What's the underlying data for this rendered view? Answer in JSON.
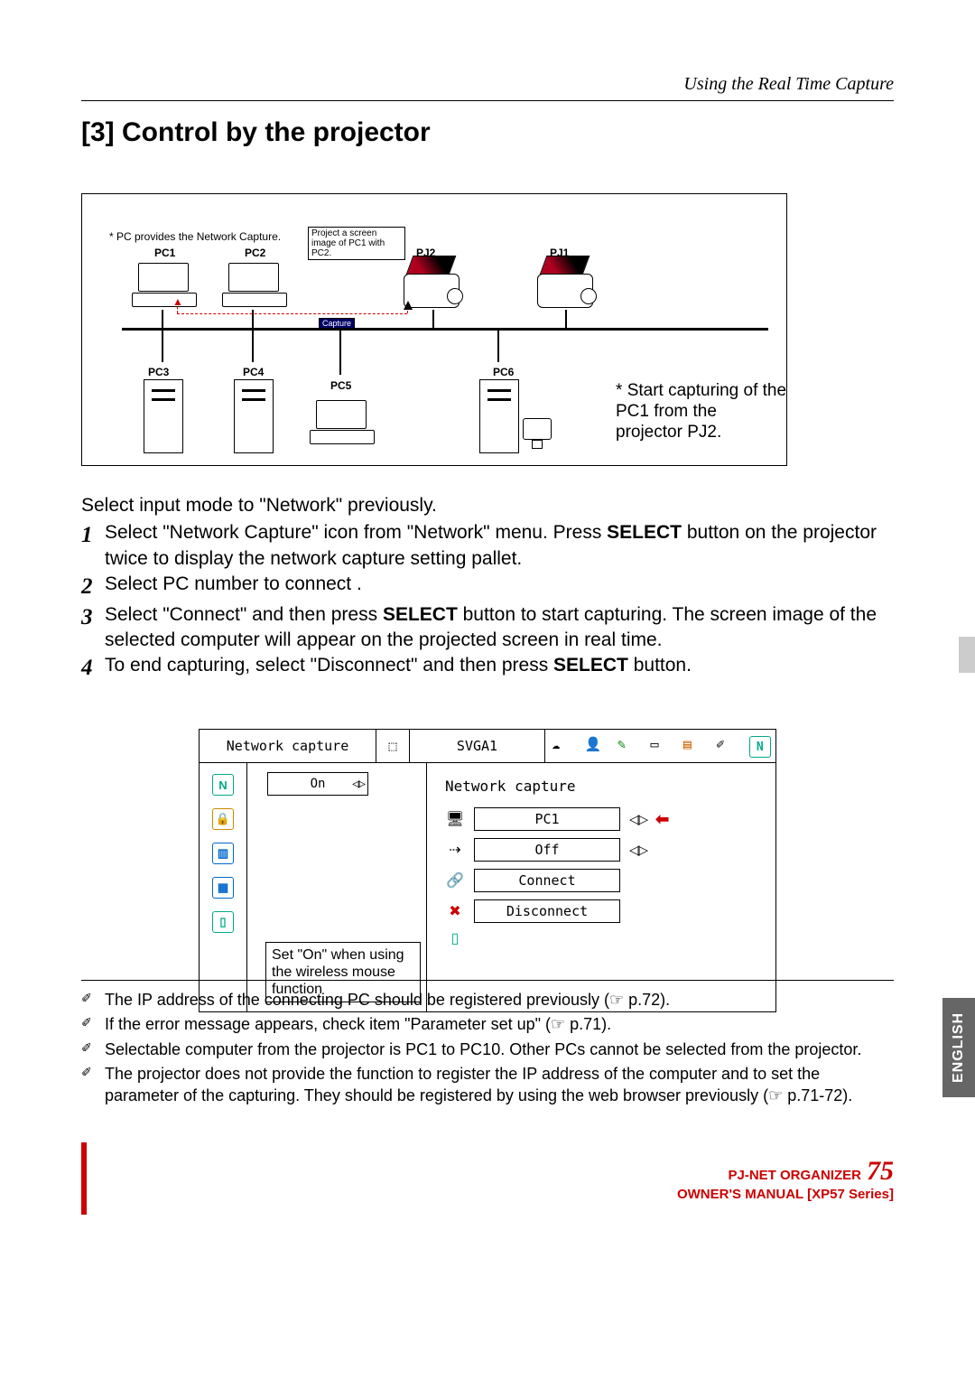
{
  "header": {
    "breadcrumb": "Using the Real Time Capture"
  },
  "section": {
    "title": "[3] Control by the projector"
  },
  "diagram1": {
    "pc_note": "* PC provides the Network Capture.",
    "project_note": "Project a screen image of PC1 with PC2.",
    "labels": {
      "pc1": "PC1",
      "pc2": "PC2",
      "pc3": "PC3",
      "pc4": "PC4",
      "pc5": "PC5",
      "pc6": "PC6",
      "pj1": "PJ1",
      "pj2": "PJ2"
    },
    "capture_btn": "Capture",
    "side_caption_prefix": "*",
    "side_caption": "Start capturing of the PC1 from the projector PJ2."
  },
  "intro": "Select input mode to \"Network\" previously.",
  "steps": {
    "s1a": "Select \"Network Capture\" icon from \"Network\" menu. Press ",
    "s1b": "SELECT",
    "s1c": " button on the projector twice to display the network capture setting pallet.",
    "s2": "Select PC number to connect .",
    "s3a": "Select \"Connect\" and then press ",
    "s3b": "SELECT",
    "s3c": " button to start capturing. The screen image of the selected computer will appear on the projected screen in real time.",
    "s4a": "To end capturing, select \"Disconnect\" and then press ",
    "s4b": "SELECT",
    "s4c": " button."
  },
  "osd": {
    "topbar_title": "Network capture",
    "topbar_mode": "SVGA1",
    "on_value": "On",
    "on_note": "Set \"On\" when using the wireless mouse function",
    "panel_title": "Network capture",
    "row_pc": "PC1",
    "row_off": "Off",
    "row_connect": "Connect",
    "row_disconnect": "Disconnect"
  },
  "footnotes": {
    "f1": "The IP address of the connecting PC should be registered previously (☞ p.72).",
    "f2": "If the error message appears, check item \"Parameter set up\" (☞ p.71).",
    "f3": "Selectable computer from the projector is PC1 to PC10. Other PCs cannot be selected from the projector.",
    "f4": "The projector does not provide the function to register the IP address of the computer and to set the parameter of the capturing. They should be registered by using the web browser previously (☞ p.71-72)."
  },
  "footer": {
    "product": "PJ-NET ORGANIZER",
    "page": "75",
    "manual": "OWNER'S MANUAL [XP57 Series]"
  },
  "lang_tab": "ENGLISH"
}
